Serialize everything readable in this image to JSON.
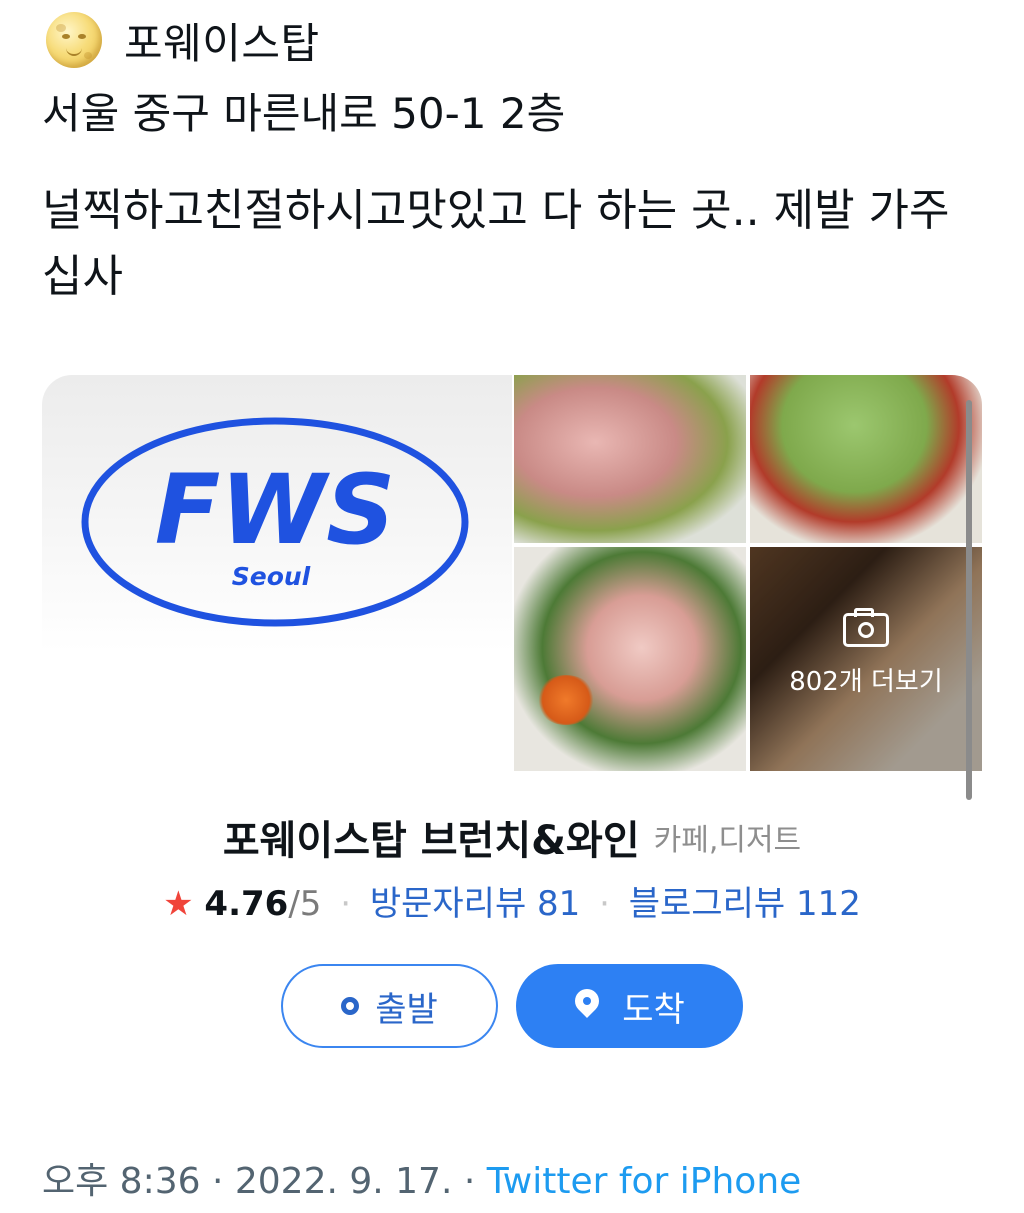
{
  "tweet": {
    "header_text": "포웨이스탑",
    "address": "서울 중구 마른내로 50-1 2층",
    "body": "널찍하고친절하시고맛있고 다 하는 곳.. 제발 가주십사"
  },
  "card": {
    "logo_main": "FWS",
    "logo_sub": "Seoul",
    "more_photos_label": "802개 더보기",
    "place_name": "포웨이스탑 브런치&와인",
    "category": "카페,디저트",
    "rating": "4.76",
    "rating_max": "/5",
    "visitor_reviews": "방문자리뷰 81",
    "blog_reviews": "블로그리뷰 112",
    "depart_button": "출발",
    "arrive_button": "도착",
    "accent_color": "#2d80f3",
    "star_color": "#f0443a",
    "logo_color": "#1f52e0"
  },
  "footer": {
    "time": "오후 8:36 · 2022. 9. 17. · ",
    "source": "Twitter for iPhone"
  }
}
